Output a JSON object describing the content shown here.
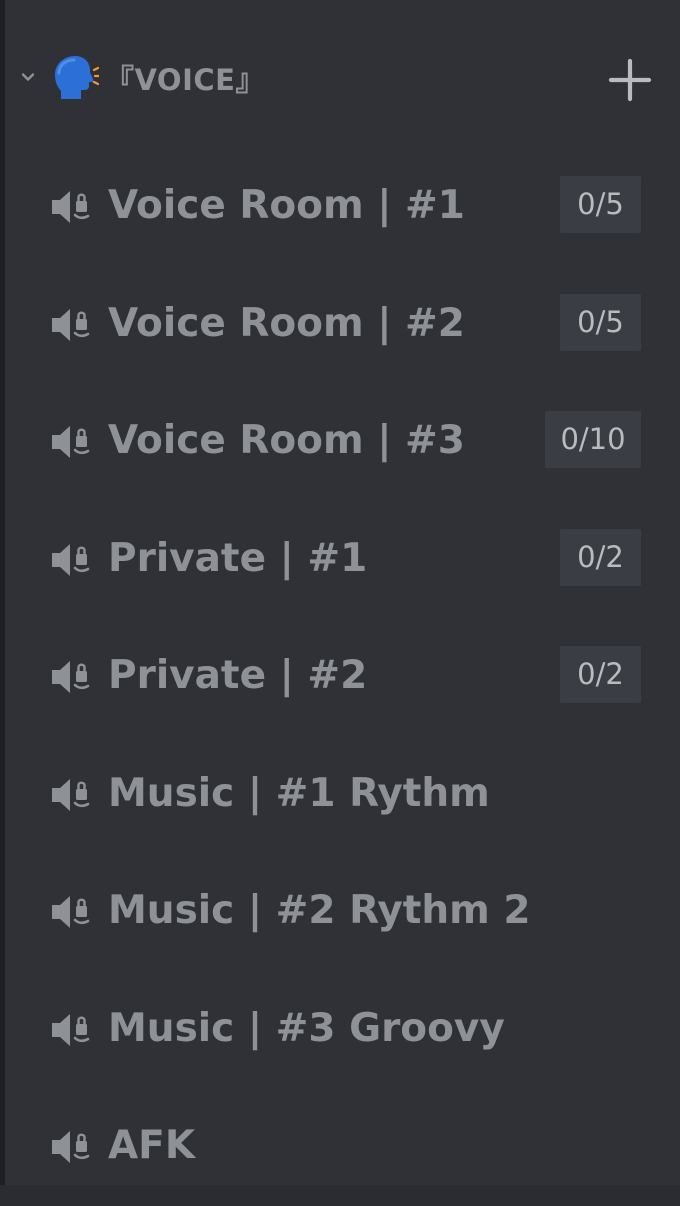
{
  "colors": {
    "background": "#2f3136",
    "text_muted": "#8e9297",
    "badge_bg": "#3a3d43",
    "badge_text": "#b9bbbe"
  },
  "category": {
    "emoji_icon": "speaking-head-icon",
    "label": "『VOICE』",
    "collapse_icon": "chevron-down-icon",
    "add_icon": "plus-icon"
  },
  "channels": [
    {
      "icon": "speaker-lock-icon",
      "name": "Voice Room | #1",
      "limit": "0/5"
    },
    {
      "icon": "speaker-lock-icon",
      "name": "Voice Room | #2",
      "limit": "0/5"
    },
    {
      "icon": "speaker-lock-icon",
      "name": "Voice Room | #3",
      "limit": "0/10"
    },
    {
      "icon": "speaker-lock-icon",
      "name": "Private | #1",
      "limit": "0/2"
    },
    {
      "icon": "speaker-lock-icon",
      "name": "Private | #2",
      "limit": "0/2"
    },
    {
      "icon": "speaker-lock-icon",
      "name": "Music | #1 Rythm",
      "limit": null
    },
    {
      "icon": "speaker-lock-icon",
      "name": "Music | #2 Rythm 2",
      "limit": null
    },
    {
      "icon": "speaker-lock-icon",
      "name": "Music | #3 Groovy",
      "limit": null
    },
    {
      "icon": "speaker-lock-icon",
      "name": "AFK",
      "limit": null
    }
  ]
}
